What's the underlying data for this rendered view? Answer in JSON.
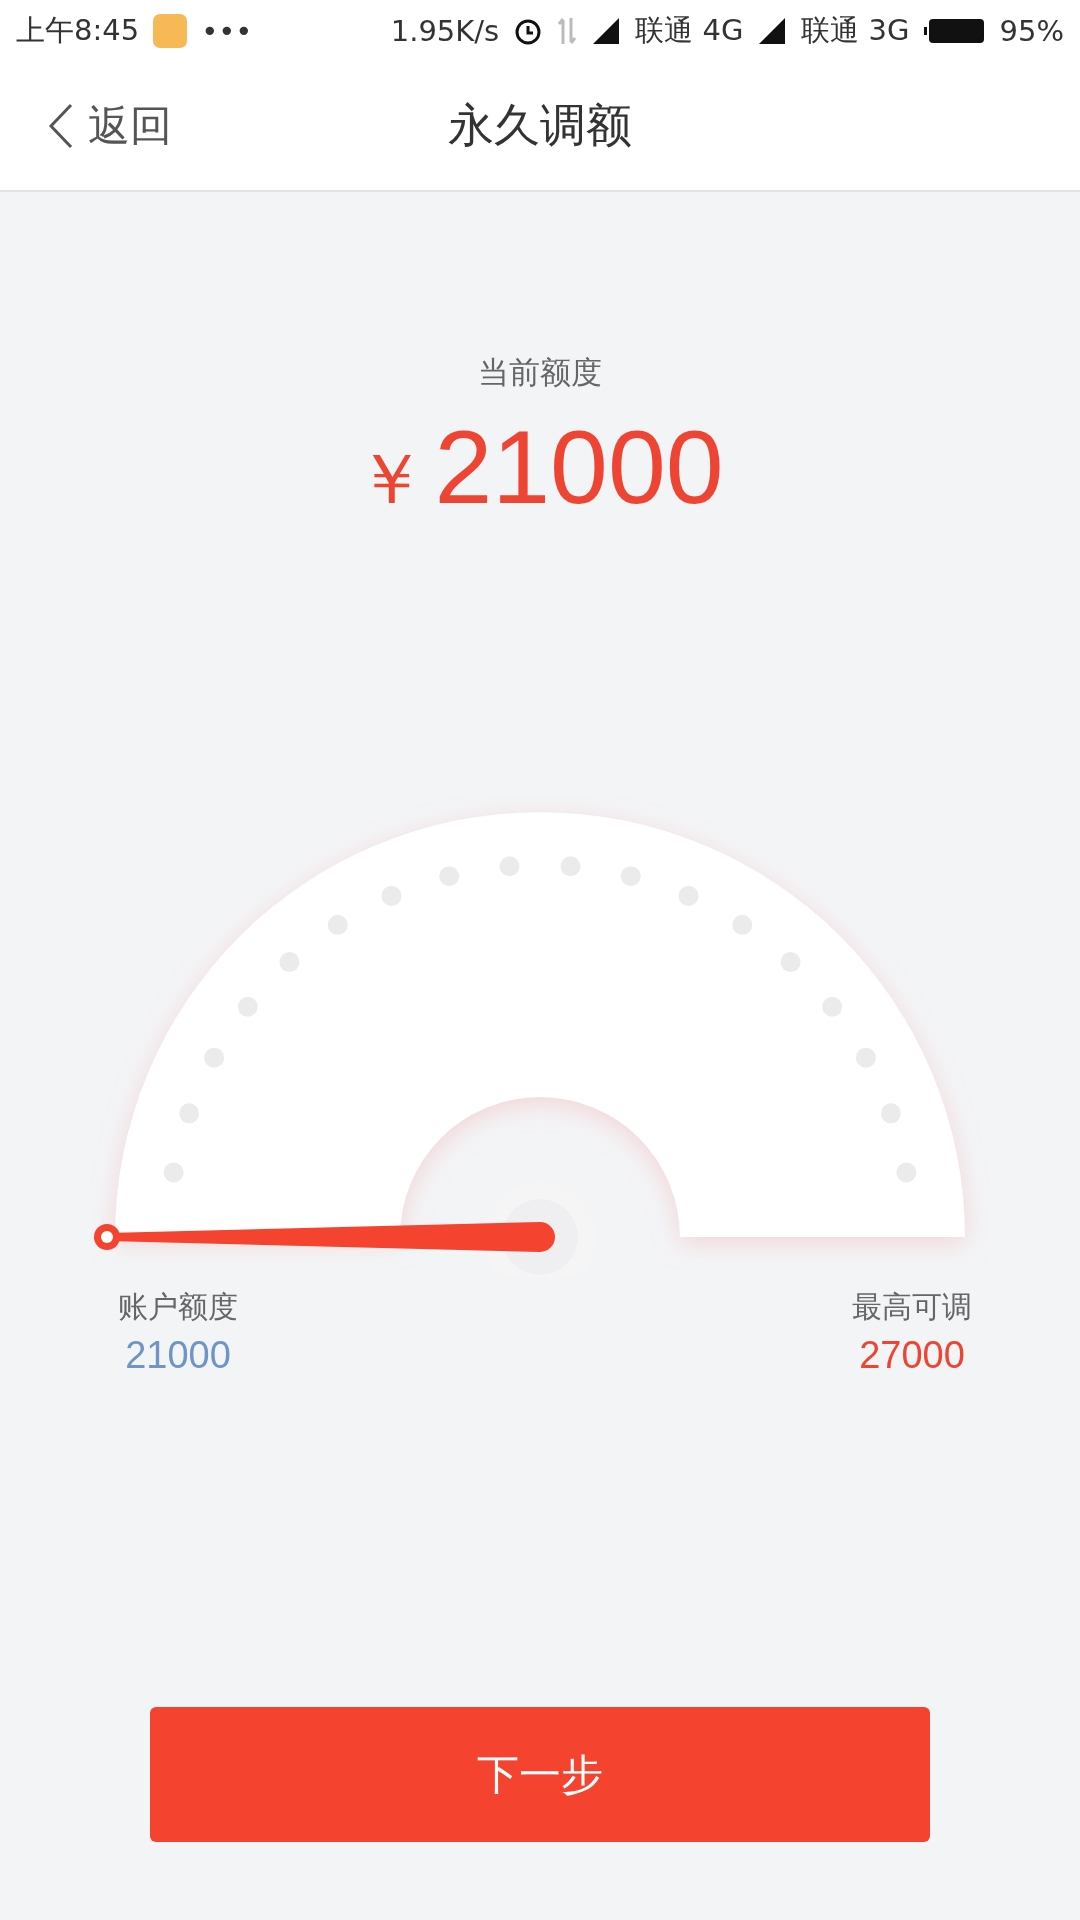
{
  "status_bar": {
    "time": "上午8:45",
    "overflow": "•••",
    "speed": "1.95K/s",
    "sim1": "联通 4G",
    "sim2": "联通 3G",
    "battery": "95%"
  },
  "nav": {
    "back": "返回",
    "title": "永久调额"
  },
  "current": {
    "label": "当前额度",
    "currency": "￥",
    "amount": "21000"
  },
  "limits": [
    {
      "label": "账户额度",
      "value": "21000",
      "color": "#6f94c8"
    },
    {
      "label": "最高可调",
      "value": "27000",
      "color": "#ee4433"
    }
  ],
  "button": "下一步"
}
